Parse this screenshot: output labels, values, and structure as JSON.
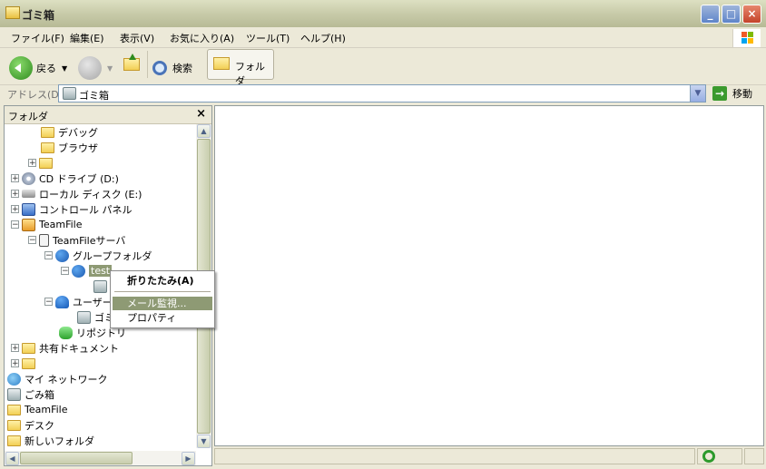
{
  "window": {
    "title": "ゴミ箱"
  },
  "menu": [
    "ファイル(F)",
    "編集(E)",
    "表示(V)",
    "お気に入り(A)",
    "ツール(T)",
    "ヘルプ(H)"
  ],
  "toolbar": {
    "back": "戻る",
    "search": "検索",
    "folders": "フォルダ"
  },
  "address": {
    "label": "アドレス(D)",
    "value": "ゴミ箱",
    "go": "移動"
  },
  "folder_pane": {
    "title": "フォルダ",
    "close": "×",
    "tree": [
      {
        "label": "デバッグ",
        "icon": "folder-icon"
      },
      {
        "label": "ブラウザ",
        "icon": "folder-icon"
      },
      {
        "label": "",
        "icon": "folder-icon",
        "expander": "+"
      },
      {
        "label": "CD ドライブ (D:)",
        "icon": "cd-drive-icon",
        "expander": "+"
      },
      {
        "label": "ローカル ディスク (E:)",
        "icon": "local-disk-icon",
        "expander": "+"
      },
      {
        "label": "コントロール パネル",
        "icon": "control-panel-icon",
        "expander": "+"
      },
      {
        "label": "TeamFile",
        "icon": "teamfile-icon",
        "expander": "−"
      },
      {
        "label": "TeamFileサーバ",
        "icon": "server-icon",
        "expander": "−"
      },
      {
        "label": "グループフォルダ",
        "icon": "group-icon",
        "expander": "−"
      },
      {
        "label": "test",
        "icon": "group-icon",
        "expander": "−"
      },
      {
        "label": "",
        "icon": "recycle-bin-icon"
      },
      {
        "label": "ユーザー",
        "icon": "user-icon",
        "expander": "−"
      },
      {
        "label": "ゴミ",
        "icon": "recycle-bin-icon"
      },
      {
        "label": "リポジトリ",
        "icon": "repository-icon"
      },
      {
        "label": "共有ドキュメント",
        "icon": "folder-icon",
        "expander": "+"
      },
      {
        "label": "",
        "icon": "folder-icon",
        "expander": "+"
      },
      {
        "label": "マイ ネットワーク",
        "icon": "network-icon"
      },
      {
        "label": "ごみ箱",
        "icon": "recycle-bin-icon"
      },
      {
        "label": "TeamFile",
        "icon": "folder-icon"
      },
      {
        "label": "デスク",
        "icon": "folder-icon"
      },
      {
        "label": "新しいフォルダ",
        "icon": "folder-icon"
      }
    ]
  },
  "context_menu": {
    "items": [
      "折りたたみ(A)",
      "メール監視...",
      "プロパティ"
    ],
    "highlighted": "メール監視..."
  },
  "colors": {
    "selection": "#8E9A74",
    "titlebar": "#C8CBA9"
  }
}
